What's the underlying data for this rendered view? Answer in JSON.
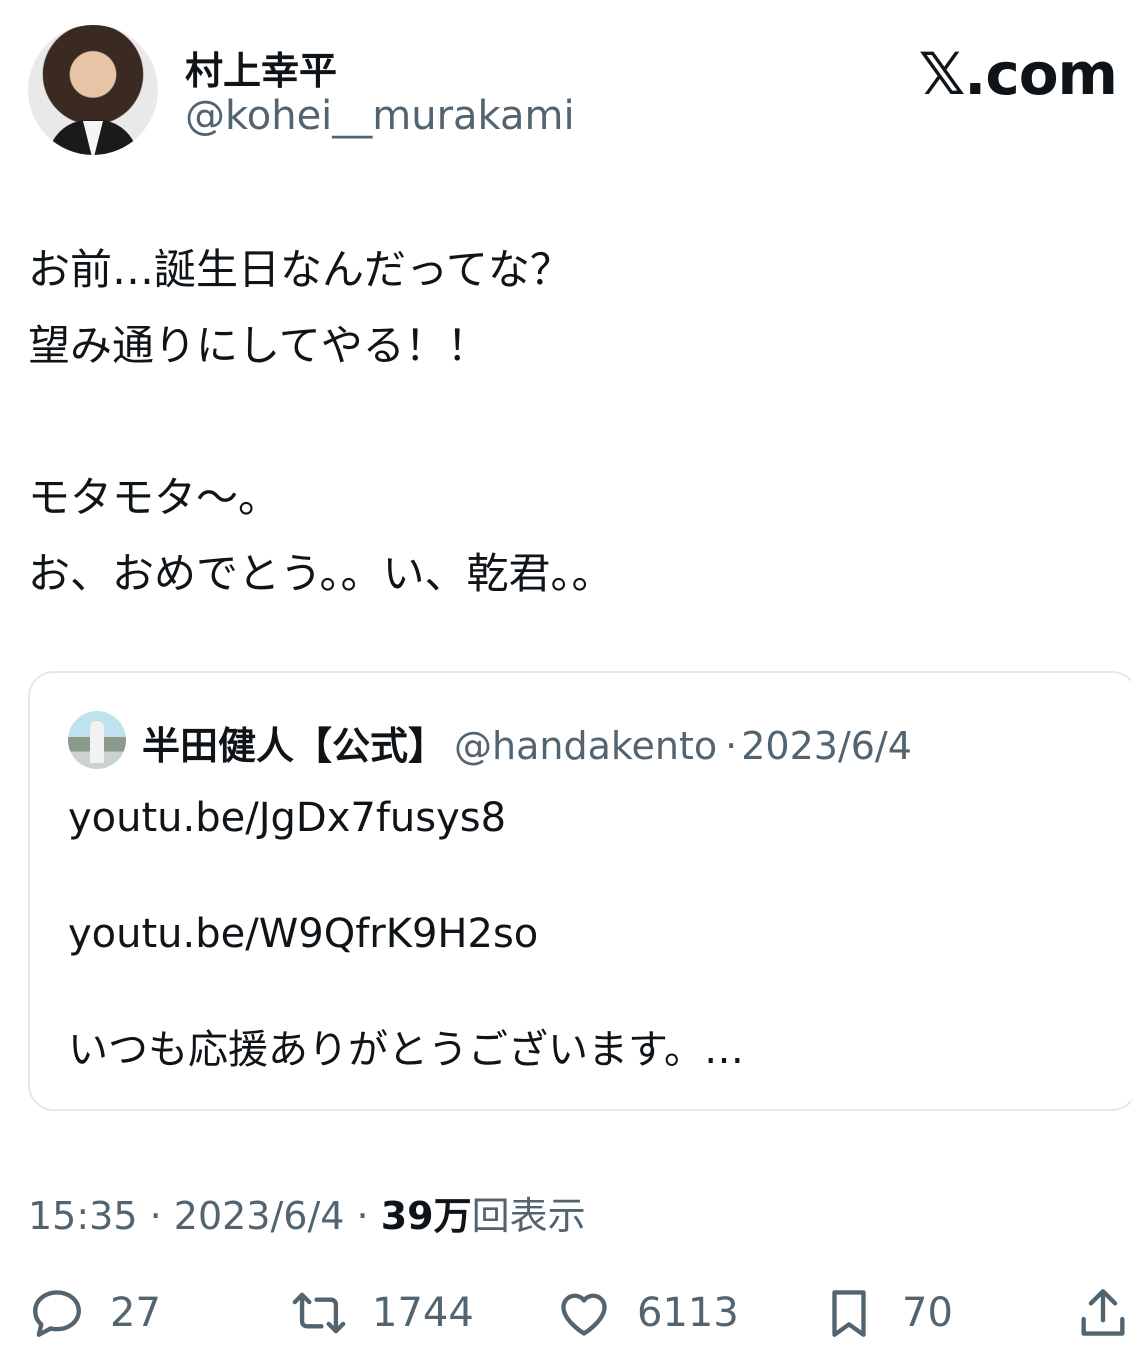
{
  "author": {
    "display_name": "村上幸平",
    "handle": "@kohei__murakami"
  },
  "brand": {
    "label": "𝕏.com"
  },
  "tweet": {
    "text": "お前…誕生日なんだってな？\n望み通りにしてやる！！\n\nモタモタ〜。\nお、おめでとう。。い、乾君。。"
  },
  "quote": {
    "display_name": "半田健人【公式】",
    "handle": "@handakento",
    "date": "2023/6/4",
    "text": "youtu.be/JgDx7fusys8\n\nyoutu.be/W9QfrK9H2so\n\nいつも応援ありがとうございます。…"
  },
  "meta": {
    "time": "15:35",
    "date": "2023/6/4",
    "views_count": "39万",
    "views_label": "回表示"
  },
  "actions": {
    "reply_count": "27",
    "retweet_count": "1744",
    "like_count": "6113",
    "bookmark_count": "70"
  },
  "icons": {
    "reply": "reply-icon",
    "retweet": "retweet-icon",
    "like": "heart-icon",
    "bookmark": "bookmark-icon",
    "share": "share-icon"
  },
  "colors": {
    "text_primary": "#0f1419",
    "text_secondary": "#536471",
    "border": "#e4e8ea"
  }
}
